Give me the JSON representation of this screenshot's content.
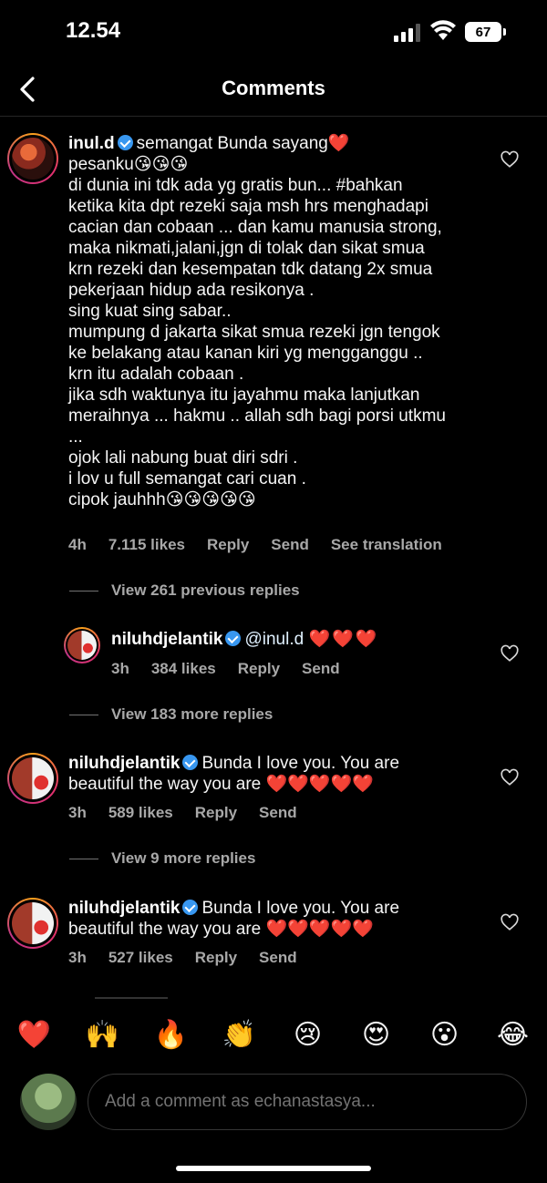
{
  "status_bar": {
    "time": "12.54",
    "battery": "67",
    "icons": [
      "signal-icon",
      "wifi-icon",
      "battery-icon"
    ]
  },
  "header": {
    "title": "Comments",
    "back_icon": "chevron-left-icon"
  },
  "comments": [
    {
      "username": "inul.d",
      "verified": true,
      "lines": [
        "semangat Bunda sayang❤️",
        "pesanku😘😘😘",
        "di dunia ini tdk ada yg gratis bun... #bahkan",
        "ketika kita dpt rezeki saja msh hrs menghadapi",
        "cacian dan cobaan ... dan kamu manusia strong,",
        "maka nikmati,jalani,jgn di tolak dan sikat smua",
        "krn rezeki dan kesempatan tdk datang 2x smua",
        "pekerjaan hidup ada resikonya .",
        "sing kuat sing sabar..",
        "mumpung d jakarta sikat smua rezeki jgn tengok",
        "ke belakang atau kanan kiri yg mengganggu ..",
        "krn itu adalah cobaan .",
        "jika sdh waktunya itu jayahmu maka lanjutkan",
        "meraihnya ... hakmu .. allah sdh bagi porsi utkmu",
        "...",
        "ojok lali nabung buat diri sdri .",
        "i lov u full semangat cari cuan .",
        "cipok jauhhh😘😘😘😘😘"
      ],
      "time": "4h",
      "likes": "7.115 likes",
      "reply": "Reply",
      "send": "Send",
      "translate": "See translation"
    },
    {
      "view_replies": "View 261 previous replies"
    },
    {
      "username": "niluhdjelantik",
      "verified": true,
      "mention": "@inul.d",
      "text": "❤️❤️❤️",
      "time": "3h",
      "likes": "384 likes",
      "reply": "Reply",
      "send": "Send"
    },
    {
      "view_replies": "View 183 more replies"
    },
    {
      "username": "niluhdjelantik",
      "verified": true,
      "line1": "Bunda I love you. You are",
      "line2": "beautiful the way you are ❤️❤️❤️❤️❤️",
      "time": "3h",
      "likes": "589 likes",
      "reply": "Reply",
      "send": "Send"
    },
    {
      "view_replies": "View 9 more replies"
    },
    {
      "username": "niluhdjelantik",
      "verified": true,
      "line1": "Bunda I love you. You are",
      "line2": "beautiful the way you are ❤️❤️❤️❤️❤️",
      "time": "3h",
      "likes": "527 likes",
      "reply": "Reply",
      "send": "Send"
    }
  ],
  "emoji_bar": [
    "❤️",
    "🙌",
    "🔥",
    "👏",
    "😢",
    "😍",
    "😮",
    "😂"
  ],
  "composer": {
    "placeholder": "Add a comment as echanastasya..."
  }
}
